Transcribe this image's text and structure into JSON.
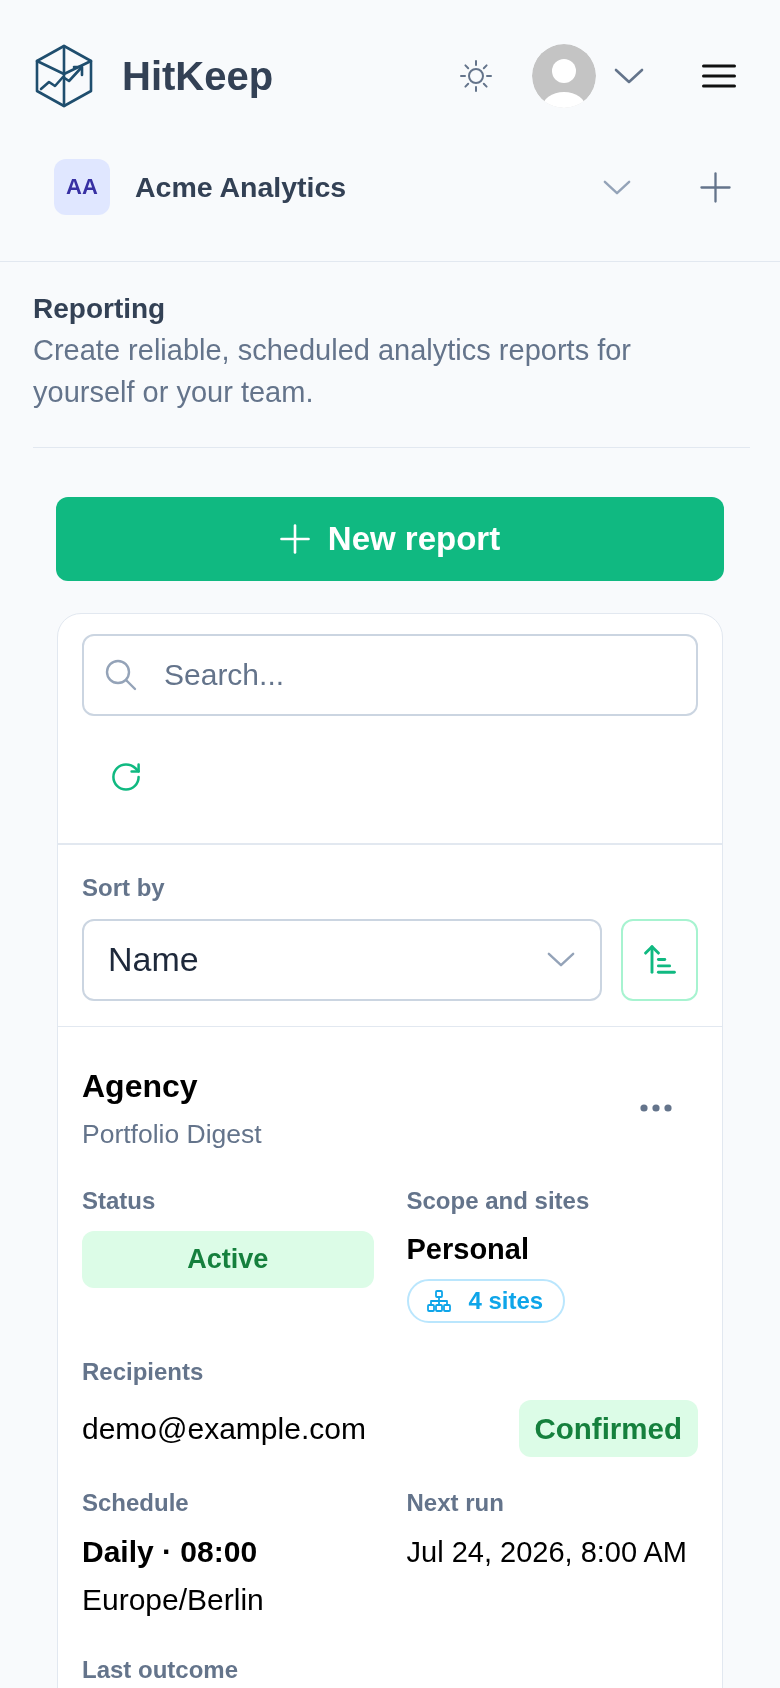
{
  "header": {
    "brand": "HitKeep"
  },
  "workspace": {
    "initials": "AA",
    "name": "Acme Analytics"
  },
  "intro": {
    "title": "Reporting",
    "description": "Create reliable, scheduled analytics reports for yourself or your team."
  },
  "new_report_button": {
    "label": "New report"
  },
  "search": {
    "placeholder": "Search..."
  },
  "sort": {
    "label": "Sort by",
    "value": "Name",
    "ascending": true
  },
  "reports": [
    {
      "title": "Agency",
      "subtitle": "Portfolio Digest",
      "status_label": "Status",
      "status": "Active",
      "active": true,
      "scope_label": "Scope and sites",
      "scope": "Personal",
      "sites": "4 sites",
      "recipients_label": "Recipients",
      "recipients": [
        {
          "email": "demo@example.com",
          "status": "Confirmed",
          "confirmed": true
        }
      ],
      "schedule_label": "Schedule",
      "schedule": "Daily · 08:00",
      "timezone": "Europe/Berlin",
      "next_run_label": "Next run",
      "next_run": "Jul 24, 2026, 8:00 AM",
      "last_outcome_label": "Last outcome"
    }
  ]
}
